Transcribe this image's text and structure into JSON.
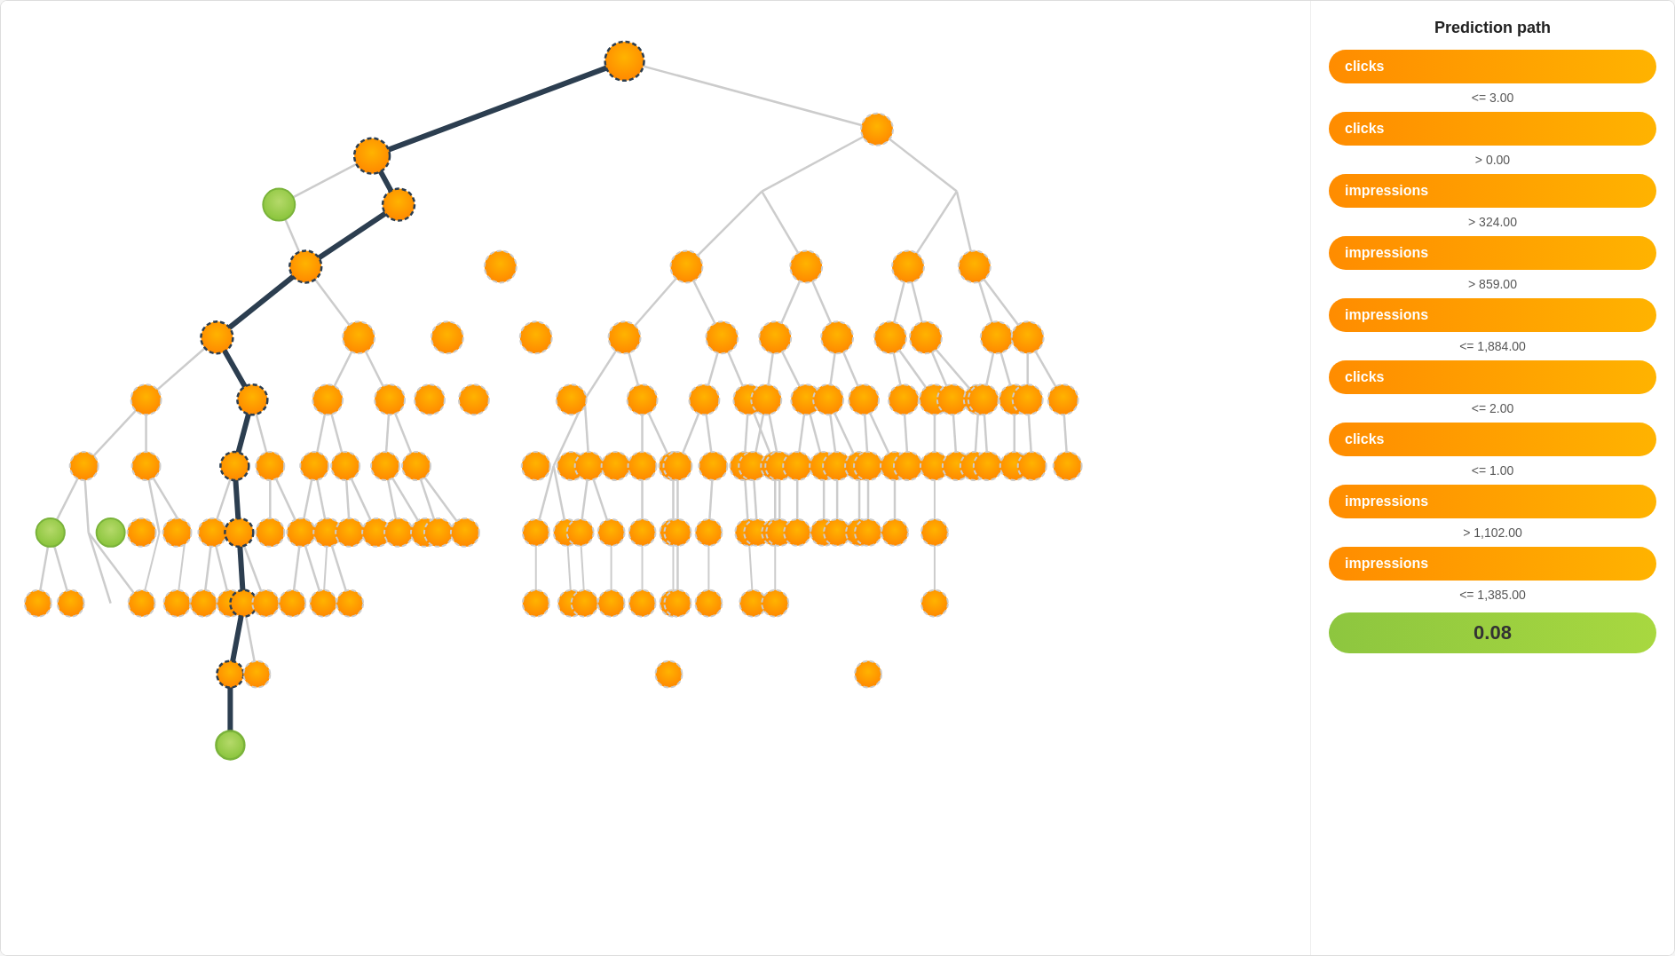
{
  "sidebar": {
    "title": "Prediction path",
    "items": [
      {
        "label": "clicks",
        "type": "orange"
      },
      {
        "condition": "<= 3.00"
      },
      {
        "label": "clicks",
        "type": "orange"
      },
      {
        "condition": "> 0.00"
      },
      {
        "label": "impressions",
        "type": "orange"
      },
      {
        "condition": "> 324.00"
      },
      {
        "label": "impressions",
        "type": "orange"
      },
      {
        "condition": "> 859.00"
      },
      {
        "label": "impressions",
        "type": "orange"
      },
      {
        "condition": "<= 1,884.00"
      },
      {
        "label": "clicks",
        "type": "orange"
      },
      {
        "condition": "<= 2.00"
      },
      {
        "label": "clicks",
        "type": "orange"
      },
      {
        "condition": "<= 1.00"
      },
      {
        "label": "impressions",
        "type": "orange"
      },
      {
        "condition": "> 1,102.00"
      },
      {
        "label": "impressions",
        "type": "orange"
      },
      {
        "condition": "<= 1,385.00"
      },
      {
        "label": "0.08",
        "type": "green"
      }
    ]
  }
}
